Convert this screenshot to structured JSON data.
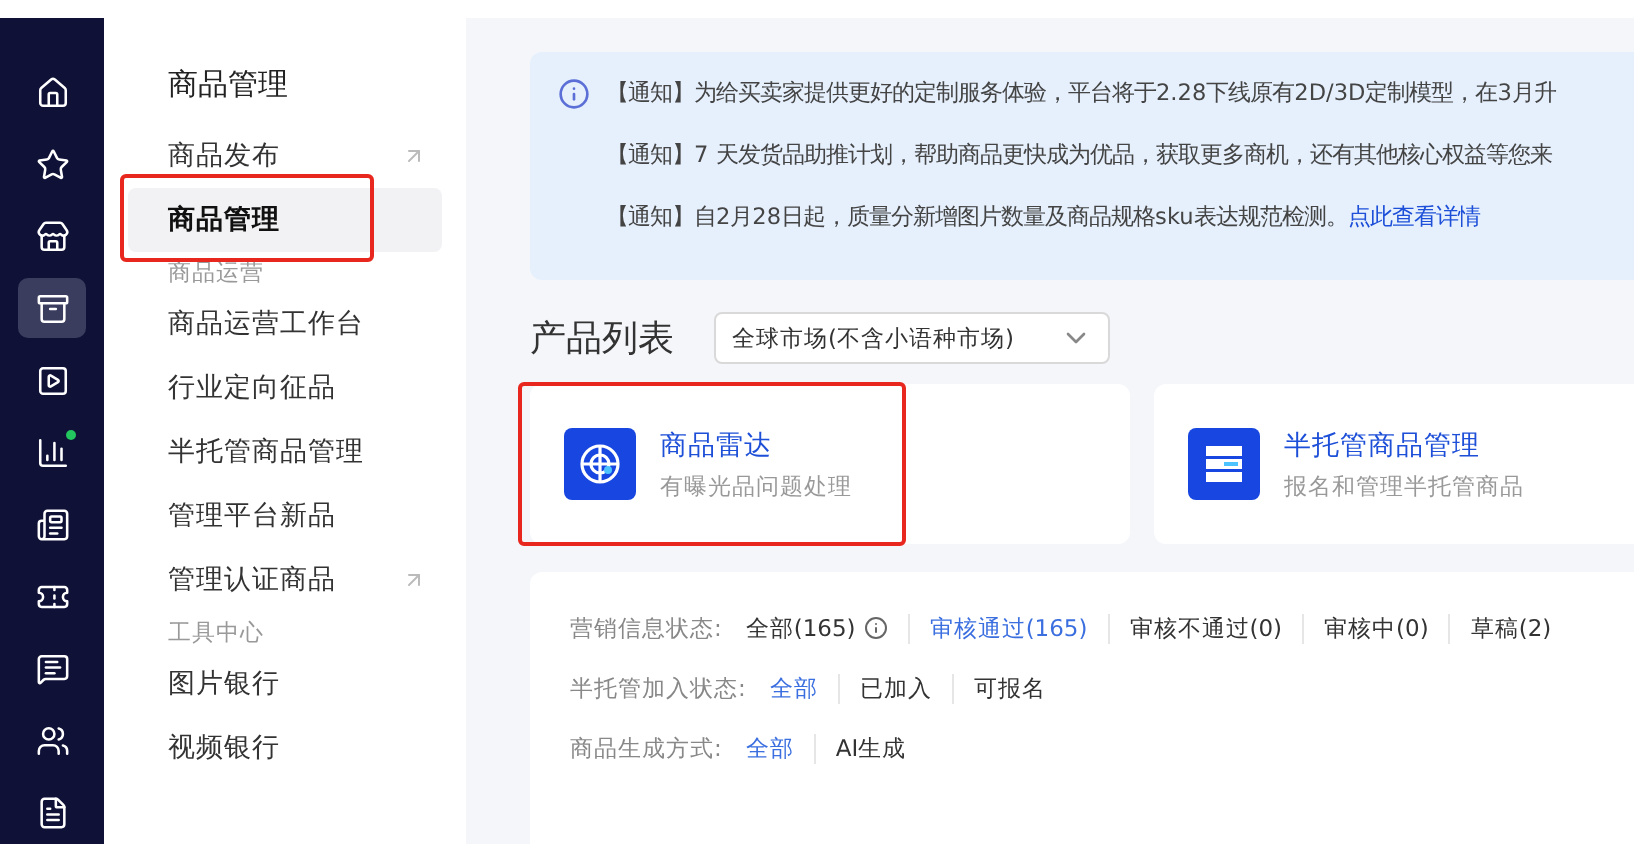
{
  "rail": {
    "items": [
      {
        "kind": "home",
        "selected": false,
        "badge": false
      },
      {
        "kind": "star",
        "selected": false,
        "badge": false
      },
      {
        "kind": "store",
        "selected": false,
        "badge": false
      },
      {
        "kind": "box",
        "selected": true,
        "badge": false
      },
      {
        "kind": "video",
        "selected": false,
        "badge": false
      },
      {
        "kind": "chart",
        "selected": false,
        "badge": true
      },
      {
        "kind": "ad",
        "selected": false,
        "badge": false
      },
      {
        "kind": "ticket",
        "selected": false,
        "badge": false
      },
      {
        "kind": "message",
        "selected": false,
        "badge": false
      },
      {
        "kind": "users",
        "selected": false,
        "badge": false
      },
      {
        "kind": "file",
        "selected": false,
        "badge": false
      }
    ]
  },
  "menu": {
    "title": "商品管理",
    "items": [
      {
        "kind": "link",
        "label": "商品发布",
        "selected": false,
        "external": true,
        "highlighted": false
      },
      {
        "kind": "link",
        "label": "商品管理",
        "selected": true,
        "external": false,
        "highlighted": true
      },
      {
        "kind": "section",
        "label": "商品运营"
      },
      {
        "kind": "link",
        "label": "商品运营工作台",
        "selected": false,
        "external": false,
        "highlighted": false
      },
      {
        "kind": "link",
        "label": "行业定向征品",
        "selected": false,
        "external": false,
        "highlighted": false
      },
      {
        "kind": "link",
        "label": "半托管商品管理",
        "selected": false,
        "external": false,
        "highlighted": false
      },
      {
        "kind": "link",
        "label": "管理平台新品",
        "selected": false,
        "external": false,
        "highlighted": false
      },
      {
        "kind": "link",
        "label": "管理认证商品",
        "selected": false,
        "external": true,
        "highlighted": false
      },
      {
        "kind": "section",
        "label": "工具中心"
      },
      {
        "kind": "link",
        "label": "图片银行",
        "selected": false,
        "external": false,
        "highlighted": false
      },
      {
        "kind": "link",
        "label": "视频银行",
        "selected": false,
        "external": false,
        "highlighted": false
      }
    ]
  },
  "notices": [
    {
      "text": "【通知】为给买卖家提供更好的定制服务体验，平台将于2.28下线原有2D/3D定制模型，在3月升"
    },
    {
      "text": "【通知】7 天发货品助推计划，帮助商品更快成为优品，获取更多商机，还有其他核心权益等您来"
    },
    {
      "text": "【通知】自2月28日起，质量分新增图片数量及商品规格sku表达规范检测。",
      "link": "点此查看详情"
    }
  ],
  "product_list": {
    "title": "产品列表",
    "market_select": {
      "value": "全球市场(不含小语种市场)"
    }
  },
  "cards": [
    {
      "kind": "radar",
      "title": "商品雷达",
      "subtitle": "有曝光品问题处理",
      "highlighted": true
    },
    {
      "kind": "server",
      "title": "半托管商品管理",
      "subtitle": "报名和管理半托管商品",
      "highlighted": false
    }
  ],
  "filters": [
    {
      "label": "营销信息状态:",
      "options": [
        {
          "label": "全部(165)",
          "selected": false,
          "info": true
        },
        {
          "label": "审核通过(165)",
          "selected": true,
          "info": false
        },
        {
          "label": "审核不通过(0)",
          "selected": false,
          "info": false
        },
        {
          "label": "审核中(0)",
          "selected": false,
          "info": false
        },
        {
          "label": "草稿(2)",
          "selected": false,
          "info": false
        }
      ]
    },
    {
      "label": "半托管加入状态:",
      "options": [
        {
          "label": "全部",
          "selected": true,
          "info": false
        },
        {
          "label": "已加入",
          "selected": false,
          "info": false
        },
        {
          "label": "可报名",
          "selected": false,
          "info": false
        }
      ]
    },
    {
      "label": "商品生成方式:",
      "options": [
        {
          "label": "全部",
          "selected": true,
          "info": false
        },
        {
          "label": "AI生成",
          "selected": false,
          "info": false
        }
      ]
    }
  ]
}
